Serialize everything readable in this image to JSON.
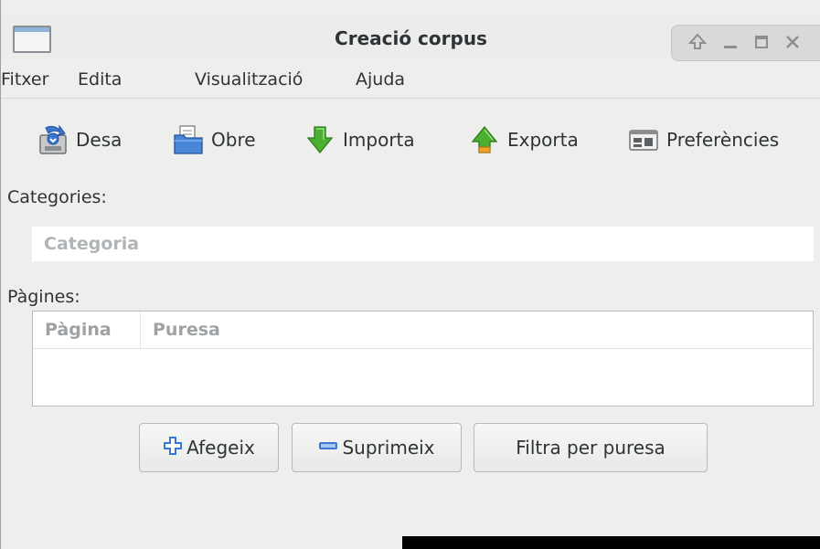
{
  "window": {
    "title": "Creació corpus",
    "icon": "window-app-icon",
    "controls": [
      "pin-icon",
      "minimize-icon",
      "maximize-icon",
      "close-icon"
    ]
  },
  "menubar": {
    "items": [
      {
        "label": "Fitxer"
      },
      {
        "label": "Edita"
      },
      {
        "label": "Visualització"
      },
      {
        "label": "Ajuda"
      }
    ]
  },
  "toolbar": {
    "items": [
      {
        "label": "Desa",
        "icon": "save-icon"
      },
      {
        "label": "Obre",
        "icon": "open-folder-icon"
      },
      {
        "label": "Importa",
        "icon": "import-arrow-icon"
      },
      {
        "label": "Exporta",
        "icon": "export-arrow-icon"
      },
      {
        "label": "Preferències",
        "icon": "preferences-icon"
      }
    ]
  },
  "categories": {
    "label": "Categories:",
    "placeholder": "Categoria",
    "value": ""
  },
  "pages": {
    "label": "Pàgines:",
    "columns": [
      "Pàgina",
      "Puresa"
    ],
    "rows": []
  },
  "actions": {
    "add_label": "Afegeix",
    "remove_label": "Suprimeix",
    "filter_label": "Filtra per puresa"
  },
  "colors": {
    "window_bg": "#eeeeec",
    "accent_blue": "#3b77d0",
    "import_green": "#4caf32",
    "text": "#2e3436"
  }
}
